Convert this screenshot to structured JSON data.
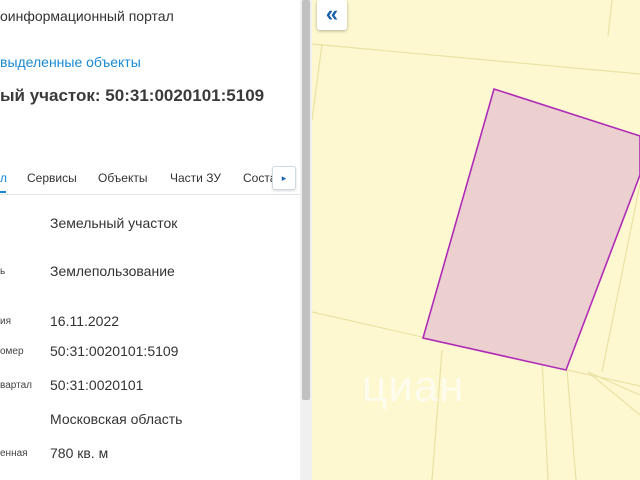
{
  "panel": {
    "portal_title": "оинформационный портал",
    "selected_objects_link": "выделенные объекты",
    "object_title": "ый участок: 50:31:0020101:5109"
  },
  "tabs": {
    "items": [
      {
        "label": "л",
        "active": true
      },
      {
        "label": "Сервисы",
        "active": false
      },
      {
        "label": "Объекты",
        "active": false
      },
      {
        "label": "Части ЗУ",
        "active": false
      },
      {
        "label": "Соста",
        "active": false
      }
    ],
    "next_glyph": "▸"
  },
  "properties": [
    {
      "label": "",
      "value": "Земельный участок"
    },
    {
      "label": "ь",
      "value": "Землепользование"
    },
    {
      "label": "ия",
      "value": "16.11.2022"
    },
    {
      "label": "омер",
      "value": "50:31:0020101:5109"
    },
    {
      "label": "вартал",
      "value": "50:31:0020101"
    },
    {
      "label": "",
      "value": "Московская область"
    },
    {
      "label": "енная",
      "value": "780 кв. м"
    }
  ],
  "map": {
    "collapse_glyph": "«",
    "watermark": "циан",
    "background_color": "#fdf8cf",
    "parcel_fill": "#ecd0d0",
    "parcel_stroke": "#b02cb8"
  }
}
